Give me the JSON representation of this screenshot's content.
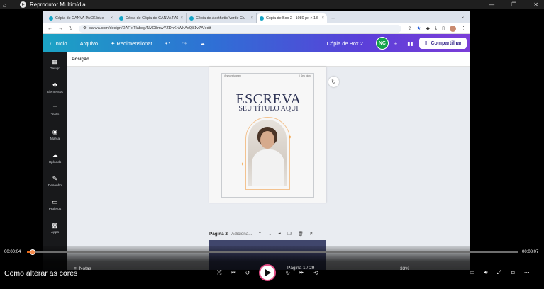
{
  "player": {
    "app_title": "Reprodutor Multimídia",
    "time_current": "00:00:04",
    "time_total": "00:08:07",
    "progress_fraction": 0.012,
    "caption": "Como alterar as cores"
  },
  "browser": {
    "tabs": [
      {
        "title": "Cópia de CANVA PACK blue -"
      },
      {
        "title": "Cópia de Cópia de CANVA PAC"
      },
      {
        "title": "Cópia de Aesthetic Verde Clu"
      },
      {
        "title": "Cópia de Box 2 - 1080 px × 13"
      }
    ],
    "url": "canva.com/design/DAFstTlabdg/NVG8mwYZDhKnWhAsQ81v7A/edit"
  },
  "canva": {
    "header": {
      "home": "Início",
      "file": "Arquivo",
      "resize": "Redimensionar",
      "doc_title": "Cópia de Box 2",
      "avatar_initials": "NC",
      "share": "Compartilhar"
    },
    "sidebar": [
      {
        "label": "Design",
        "icon": "design-icon",
        "glyph": "▦"
      },
      {
        "label": "Elementos",
        "icon": "elements-icon",
        "glyph": "❖"
      },
      {
        "label": "Texto",
        "icon": "text-icon",
        "glyph": "T"
      },
      {
        "label": "Marca",
        "icon": "brand-icon",
        "glyph": "◉"
      },
      {
        "label": "Uploads",
        "icon": "upload-icon",
        "glyph": "☁"
      },
      {
        "label": "Desenho",
        "icon": "draw-icon",
        "glyph": "✎"
      },
      {
        "label": "Projetos",
        "icon": "folder-icon",
        "glyph": "▭"
      },
      {
        "label": "Apps",
        "icon": "apps-icon",
        "glyph": "▩"
      }
    ],
    "toolbar_label": "Posição",
    "page1": {
      "tiny_left": "@seuinstagram",
      "tiny_right": "/ Seu nicho",
      "headline": "ESCREVA",
      "subline": "SEU TÍTULO AQUI"
    },
    "page2": {
      "label_bold": "Página 2",
      "label_rest": " - Adiciona..."
    },
    "footer": {
      "notes": "Notas",
      "page_indicator": "Página 1 / 29",
      "zoom": "33%"
    }
  },
  "colors": {
    "accent": "#e76a1b",
    "headline": "#2c3153",
    "gold": "#f3c28f"
  }
}
